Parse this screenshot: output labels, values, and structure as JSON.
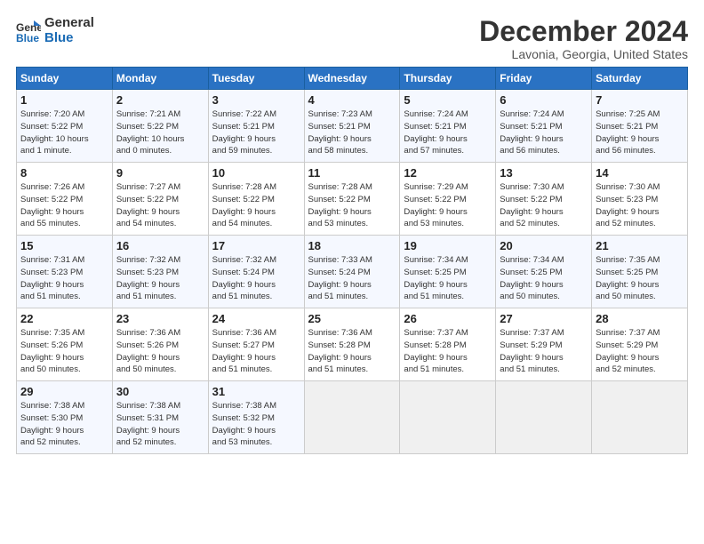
{
  "header": {
    "logo_line1": "General",
    "logo_line2": "Blue",
    "month": "December 2024",
    "location": "Lavonia, Georgia, United States"
  },
  "weekdays": [
    "Sunday",
    "Monday",
    "Tuesday",
    "Wednesday",
    "Thursday",
    "Friday",
    "Saturday"
  ],
  "weeks": [
    [
      {
        "day": "1",
        "info": "Sunrise: 7:20 AM\nSunset: 5:22 PM\nDaylight: 10 hours\nand 1 minute."
      },
      {
        "day": "2",
        "info": "Sunrise: 7:21 AM\nSunset: 5:22 PM\nDaylight: 10 hours\nand 0 minutes."
      },
      {
        "day": "3",
        "info": "Sunrise: 7:22 AM\nSunset: 5:21 PM\nDaylight: 9 hours\nand 59 minutes."
      },
      {
        "day": "4",
        "info": "Sunrise: 7:23 AM\nSunset: 5:21 PM\nDaylight: 9 hours\nand 58 minutes."
      },
      {
        "day": "5",
        "info": "Sunrise: 7:24 AM\nSunset: 5:21 PM\nDaylight: 9 hours\nand 57 minutes."
      },
      {
        "day": "6",
        "info": "Sunrise: 7:24 AM\nSunset: 5:21 PM\nDaylight: 9 hours\nand 56 minutes."
      },
      {
        "day": "7",
        "info": "Sunrise: 7:25 AM\nSunset: 5:21 PM\nDaylight: 9 hours\nand 56 minutes."
      }
    ],
    [
      {
        "day": "8",
        "info": "Sunrise: 7:26 AM\nSunset: 5:22 PM\nDaylight: 9 hours\nand 55 minutes."
      },
      {
        "day": "9",
        "info": "Sunrise: 7:27 AM\nSunset: 5:22 PM\nDaylight: 9 hours\nand 54 minutes."
      },
      {
        "day": "10",
        "info": "Sunrise: 7:28 AM\nSunset: 5:22 PM\nDaylight: 9 hours\nand 54 minutes."
      },
      {
        "day": "11",
        "info": "Sunrise: 7:28 AM\nSunset: 5:22 PM\nDaylight: 9 hours\nand 53 minutes."
      },
      {
        "day": "12",
        "info": "Sunrise: 7:29 AM\nSunset: 5:22 PM\nDaylight: 9 hours\nand 53 minutes."
      },
      {
        "day": "13",
        "info": "Sunrise: 7:30 AM\nSunset: 5:22 PM\nDaylight: 9 hours\nand 52 minutes."
      },
      {
        "day": "14",
        "info": "Sunrise: 7:30 AM\nSunset: 5:23 PM\nDaylight: 9 hours\nand 52 minutes."
      }
    ],
    [
      {
        "day": "15",
        "info": "Sunrise: 7:31 AM\nSunset: 5:23 PM\nDaylight: 9 hours\nand 51 minutes."
      },
      {
        "day": "16",
        "info": "Sunrise: 7:32 AM\nSunset: 5:23 PM\nDaylight: 9 hours\nand 51 minutes."
      },
      {
        "day": "17",
        "info": "Sunrise: 7:32 AM\nSunset: 5:24 PM\nDaylight: 9 hours\nand 51 minutes."
      },
      {
        "day": "18",
        "info": "Sunrise: 7:33 AM\nSunset: 5:24 PM\nDaylight: 9 hours\nand 51 minutes."
      },
      {
        "day": "19",
        "info": "Sunrise: 7:34 AM\nSunset: 5:25 PM\nDaylight: 9 hours\nand 51 minutes."
      },
      {
        "day": "20",
        "info": "Sunrise: 7:34 AM\nSunset: 5:25 PM\nDaylight: 9 hours\nand 50 minutes."
      },
      {
        "day": "21",
        "info": "Sunrise: 7:35 AM\nSunset: 5:25 PM\nDaylight: 9 hours\nand 50 minutes."
      }
    ],
    [
      {
        "day": "22",
        "info": "Sunrise: 7:35 AM\nSunset: 5:26 PM\nDaylight: 9 hours\nand 50 minutes."
      },
      {
        "day": "23",
        "info": "Sunrise: 7:36 AM\nSunset: 5:26 PM\nDaylight: 9 hours\nand 50 minutes."
      },
      {
        "day": "24",
        "info": "Sunrise: 7:36 AM\nSunset: 5:27 PM\nDaylight: 9 hours\nand 51 minutes."
      },
      {
        "day": "25",
        "info": "Sunrise: 7:36 AM\nSunset: 5:28 PM\nDaylight: 9 hours\nand 51 minutes."
      },
      {
        "day": "26",
        "info": "Sunrise: 7:37 AM\nSunset: 5:28 PM\nDaylight: 9 hours\nand 51 minutes."
      },
      {
        "day": "27",
        "info": "Sunrise: 7:37 AM\nSunset: 5:29 PM\nDaylight: 9 hours\nand 51 minutes."
      },
      {
        "day": "28",
        "info": "Sunrise: 7:37 AM\nSunset: 5:29 PM\nDaylight: 9 hours\nand 52 minutes."
      }
    ],
    [
      {
        "day": "29",
        "info": "Sunrise: 7:38 AM\nSunset: 5:30 PM\nDaylight: 9 hours\nand 52 minutes."
      },
      {
        "day": "30",
        "info": "Sunrise: 7:38 AM\nSunset: 5:31 PM\nDaylight: 9 hours\nand 52 minutes."
      },
      {
        "day": "31",
        "info": "Sunrise: 7:38 AM\nSunset: 5:32 PM\nDaylight: 9 hours\nand 53 minutes."
      },
      {
        "day": "",
        "info": ""
      },
      {
        "day": "",
        "info": ""
      },
      {
        "day": "",
        "info": ""
      },
      {
        "day": "",
        "info": ""
      }
    ]
  ]
}
